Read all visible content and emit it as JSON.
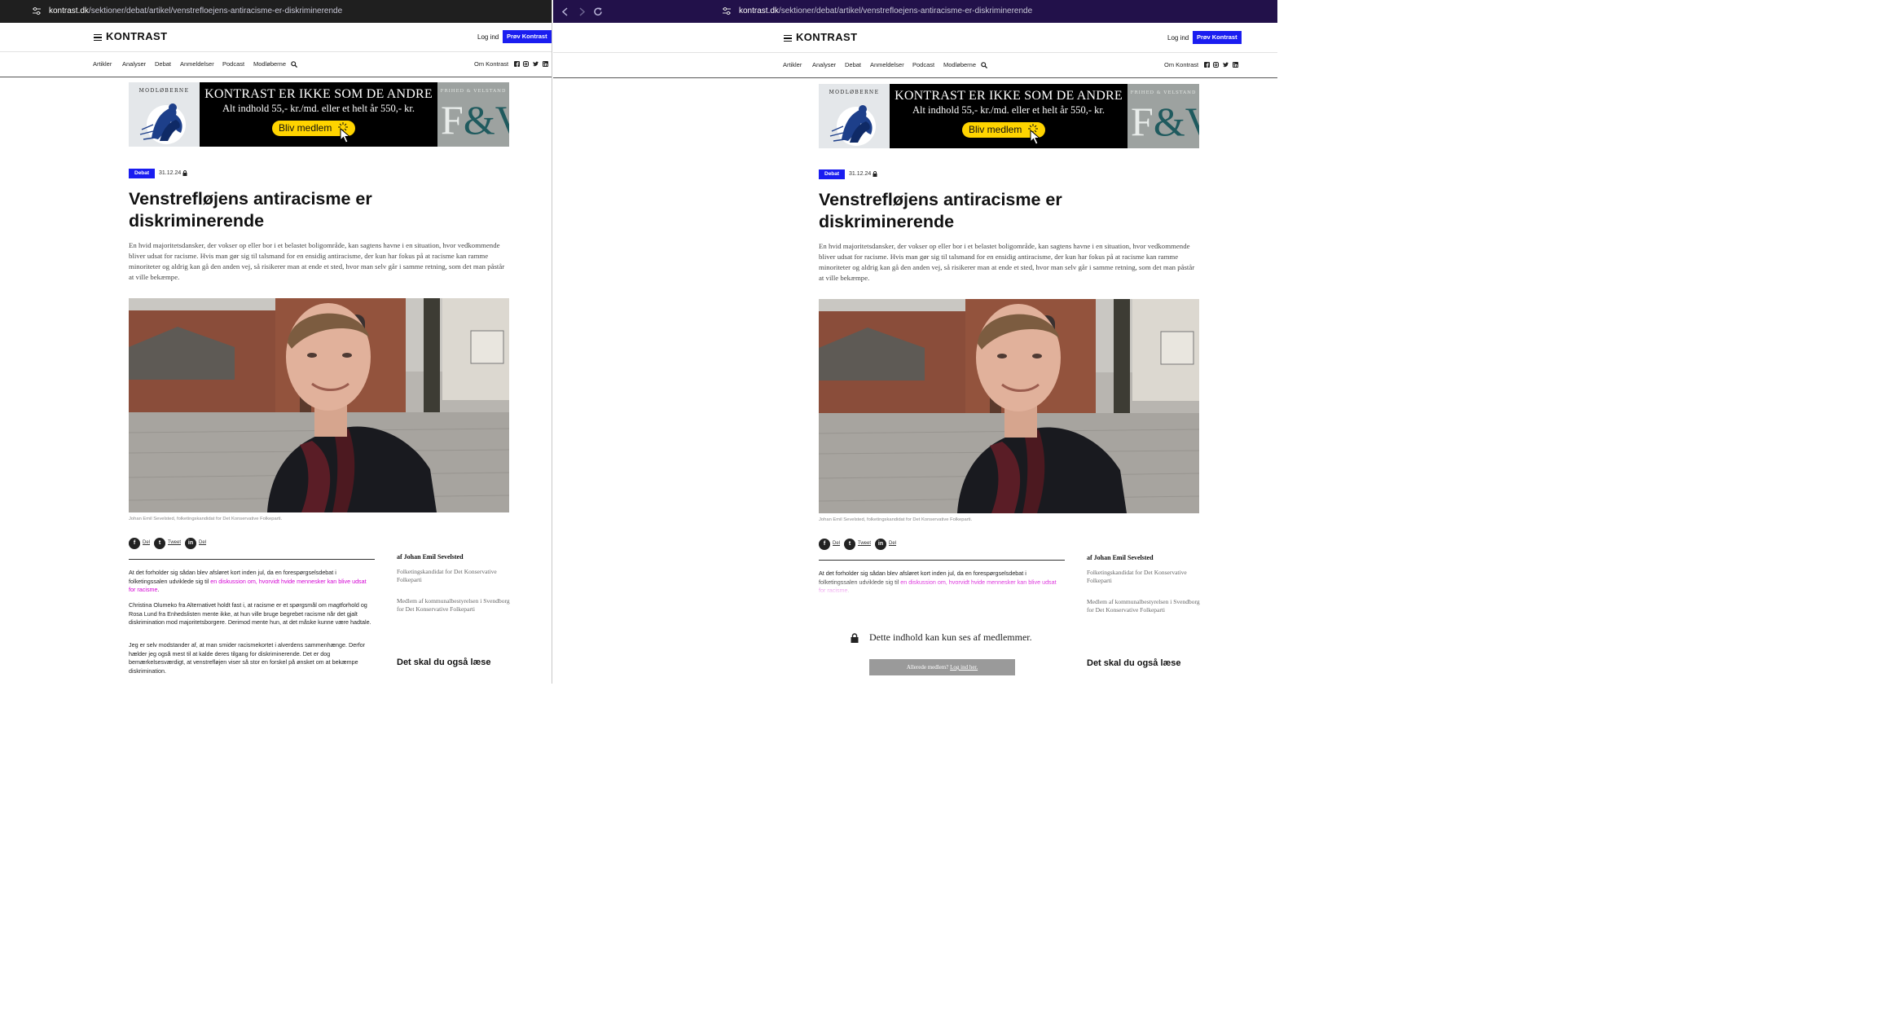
{
  "browser": {
    "url_host": "kontrast.dk",
    "url_path": "/sektioner/debat/artikel/venstrefloejens-antiracisme-er-diskriminerende"
  },
  "header": {
    "logo": "KONTRAST",
    "login": "Log ind",
    "try": "Prøv Kontrast"
  },
  "nav": {
    "items": [
      "Artikler",
      "Analyser",
      "Debat",
      "Anmeldelser",
      "Podcast",
      "Modløberne"
    ],
    "about": "Om Kontrast",
    "social_icons": [
      "facebook-icon",
      "instagram-icon",
      "twitter-icon",
      "linkedin-icon"
    ]
  },
  "banner": {
    "left_brand": "MODLØBERNE",
    "headline": "KONTRAST ER IKKE SOM DE ANDRE",
    "subline": "Alt indhold 55,- kr./md. eller et helt år 550,- kr.",
    "cta": "Bliv medlem",
    "right_brand": "FRIHED & VELSTAND",
    "right_logo": "F&V"
  },
  "article": {
    "section": "Debat",
    "date": "31.12.24",
    "title": "Venstrefløjens antiracisme er diskriminerende",
    "lede": "En hvid majoritetsdansker, der vokser op eller bor i et belastet boligområde, kan sagtens havne i en situation, hvor vedkommende bliver udsat for racisme. Hvis man gør sig til talsmand for en ensidig antiracisme, der kun har fokus på at racisme kan ramme minoriteter og aldrig kan gå den anden vej, så risikerer man at ende et sted, hvor man selv går i samme retning, som det man påstår at ville bekæmpe.",
    "caption": "Johan Emil Sevelsted, folketingskandidat for Det Konservative Folkeparti.",
    "share": [
      "Del",
      "Tweet",
      "Del"
    ],
    "p1_text": "At det forholder sig sådan blev afsløret kort inden jul, da en forespørgselsdebat i folketingssalen udviklede sig til ",
    "p1_link": "en diskussion om, hvorvidt hvide mennesker kan blive udsat for racisme",
    "p1_end": ".",
    "p2": "Christina Olumeko fra Alternativet holdt fast i, at racisme er et spørgsmål om magtforhold og Rosa Lund fra Enhedslisten mente ikke, at hun ville bruge begrebet racisme når det gjalt diskrimination mod majoritetsborgere. Derimod mente hun, at det måske kunne være hadtale.",
    "p3": "Jeg er selv modstander af, at man smider racismekortet i alverdens sammenhænge. Derfor hælder jeg også mest til at kalde deres tilgang for diskriminerende. Det er dog bemærkelsesværdigt, at venstrefløjen viser så stor en forskel på ønsket om at bekæmpe diskrimination.",
    "author": "af Johan Emil Sevelsted",
    "author_role_1": "Folketingskandidat for Det Konservative Folkeparti",
    "author_role_2": "Medlem af kommunalbestyrelsen i Svendborg for Det Konservative Folkeparti",
    "also_read": "Det skal du også læse"
  },
  "paywall": {
    "text": "Dette indhold kan kun ses af medlemmer.",
    "button_text": "Allerede medlem? ",
    "button_link": "Log ind her."
  },
  "colors": {
    "accent_blue": "#1a1df0",
    "link_magenta": "#d400d4",
    "left_urlbar": "#1f1f1f",
    "right_urlbar": "#22114a",
    "banner_yellow": "#ffd400"
  }
}
